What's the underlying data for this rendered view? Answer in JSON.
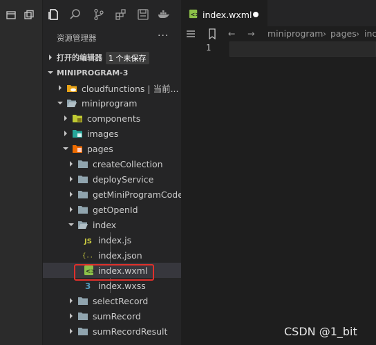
{
  "explorer": {
    "title": "资源管理器",
    "more_label": "···",
    "open_editors": {
      "label": "打开的编辑器",
      "badge": "1 个未保存"
    },
    "project": {
      "label": "MINIPROGRAM-3"
    },
    "items": [
      {
        "name": "cloudfunctions | 当前...",
        "type": "folder-cloud",
        "expanded": false
      },
      {
        "name": "miniprogram",
        "type": "folder",
        "expanded": true
      },
      {
        "name": "components",
        "type": "folder-components",
        "expanded": false
      },
      {
        "name": "images",
        "type": "folder-images",
        "expanded": false
      },
      {
        "name": "pages",
        "type": "folder-pages",
        "expanded": true
      },
      {
        "name": "createCollection",
        "type": "folder",
        "expanded": false
      },
      {
        "name": "deployService",
        "type": "folder",
        "expanded": false
      },
      {
        "name": "getMiniProgramCode",
        "type": "folder",
        "expanded": false
      },
      {
        "name": "getOpenId",
        "type": "folder",
        "expanded": false
      },
      {
        "name": "index",
        "type": "folder",
        "expanded": true
      },
      {
        "name": "index.js",
        "type": "file-js"
      },
      {
        "name": "index.json",
        "type": "file-json"
      },
      {
        "name": "index.wxml",
        "type": "file-wxml",
        "selected": true
      },
      {
        "name": "index.wxss",
        "type": "file-wxss"
      },
      {
        "name": "selectRecord",
        "type": "folder",
        "expanded": false
      },
      {
        "name": "sumRecord",
        "type": "folder",
        "expanded": false
      },
      {
        "name": "sumRecordResult",
        "type": "folder",
        "expanded": false
      }
    ]
  },
  "editor": {
    "tab": {
      "label": "index.wxml",
      "unsaved": true
    },
    "breadcrumbs": [
      "miniprogram",
      "pages",
      "inc"
    ],
    "line_number": "1"
  },
  "watermark": "CSDN @1_bit",
  "colors": {
    "highlight": "#e0302b",
    "folder": "#c5c5c5",
    "wxml": "#8dc149",
    "wxss": "#519aba",
    "js": "#cbcb41"
  }
}
